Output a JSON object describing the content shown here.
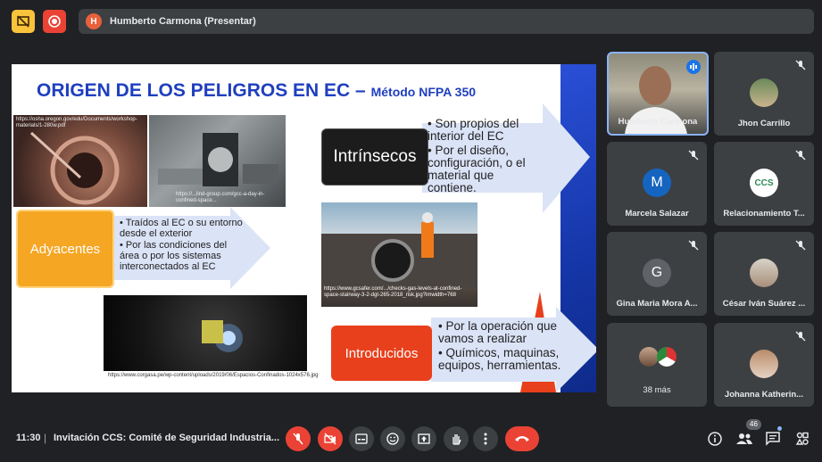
{
  "meeting": {
    "presenter_initial": "H",
    "presenter_label": "Humberto Carmona (Presentar)",
    "time": "11:30",
    "separator": "|",
    "meeting_title": "Invitación CCS: Comité de Seguridad Industria...",
    "participants_count": "46"
  },
  "slide": {
    "title": "ORIGEN DE LOS PELIGROS EN EC –",
    "title_sub": "Método NFPA 350",
    "photo1_caption": "https://osha.oregon.gov/edu/Documents/workshop-materials/1-280w.pdf",
    "photo2_caption": "https://...lind-group.com/gcc-a-day-in-confined-space...",
    "photo3_caption": "https://www.gcsafer.com/.../checks-gas-levels-at-confined-space-stairway-3-2-dgt-265-2018_risk.jpg?imwidth=768",
    "photo4_caption": "https://www.corgasa.pe/wp-content/uploads/2019/06/Espacios-Confinados-1024x576.jpg",
    "adyacentes_label": "Adyacentes",
    "adyacentes_bullets": [
      "• Traídos al EC o su entorno desde el exterior",
      "• Por las condiciones del área o por los sistemas interconectados al EC"
    ],
    "intrinsecos_label": "Intrínsecos",
    "intrinsecos_bullets": [
      "• Son propios del interior del EC",
      "• Por el diseño, configuración, o el material que contiene."
    ],
    "introducidos_label": "Introducidos",
    "introducidos_bullets": [
      "• Por la operación que vamos a realizar",
      "• Químicos, maquinas, equipos, herramientas."
    ]
  },
  "participants": [
    {
      "name": "Humberto Carmona",
      "type": "video"
    },
    {
      "name": "Jhon Carrillo",
      "type": "photo"
    },
    {
      "name": "Marcela Salazar",
      "initial": "M",
      "type": "initial"
    },
    {
      "name": "Relacionamiento T...",
      "avatar_text": "CCS",
      "type": "logo"
    },
    {
      "name": "Gina Maria Mora A...",
      "initial": "G",
      "type": "initial"
    },
    {
      "name": "César Iván Suárez ...",
      "type": "photo"
    },
    {
      "name": "38 más",
      "type": "more"
    },
    {
      "name": "Johanna Katherin...",
      "type": "photo"
    }
  ],
  "colors": {
    "background": "#202124",
    "tile": "#3c4043",
    "end_call": "#ea4335",
    "muted_button": "#ea4335",
    "title_blue": "#1f3fbf",
    "active_speaker": "#8ab4f8",
    "adyacentes": "#f5a623",
    "introducidos": "#e8401c"
  }
}
